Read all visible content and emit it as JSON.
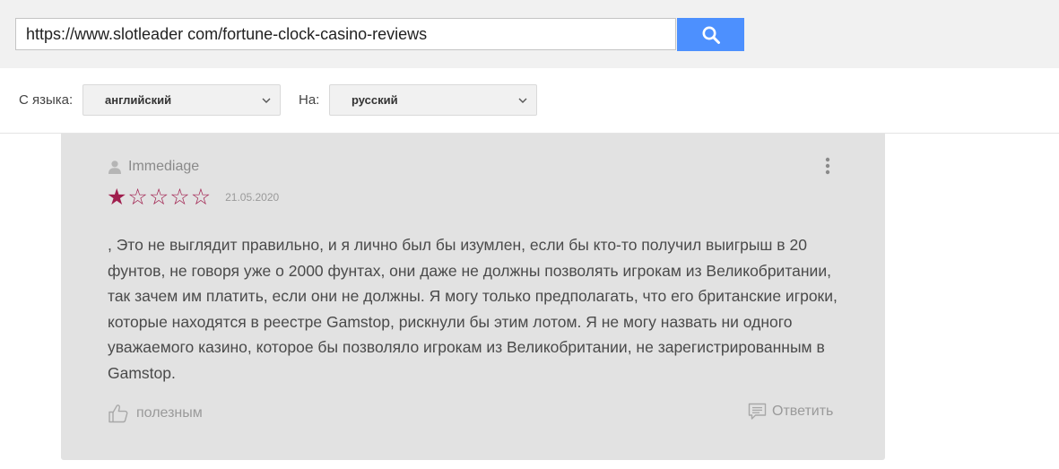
{
  "url_bar": {
    "value": "https://www.slotleader com/fortune-clock-casino-reviews",
    "search_icon": "search-icon",
    "accent_color": "#4d90fe"
  },
  "translate": {
    "from_label": "С языка:",
    "from_value": "английский",
    "to_label": "На:",
    "to_value": "русский"
  },
  "review": {
    "author": "Immediage",
    "rating": 1,
    "rating_max": 5,
    "star_color": "#a01f4e",
    "date": "21.05.2020",
    "text": ", Это не выглядит правильно, и я лично был бы изумлен, если бы кто-то получил выигрыш в 20 фунтов, не говоря уже о 2000 фунтах, они даже не должны позволять игрокам из Великобритании, так зачем им платить, если они не должны. Я могу только предполагать, что его британские игроки, которые находятся в реестре Gamstop, рискнули бы этим лотом. Я не могу назвать ни одного уважаемого казино, которое бы позволяло игрокам из Великобритании, не зарегистрированным в Gamstop.",
    "helpful_label": "полезным",
    "reply_label": "Ответить"
  }
}
